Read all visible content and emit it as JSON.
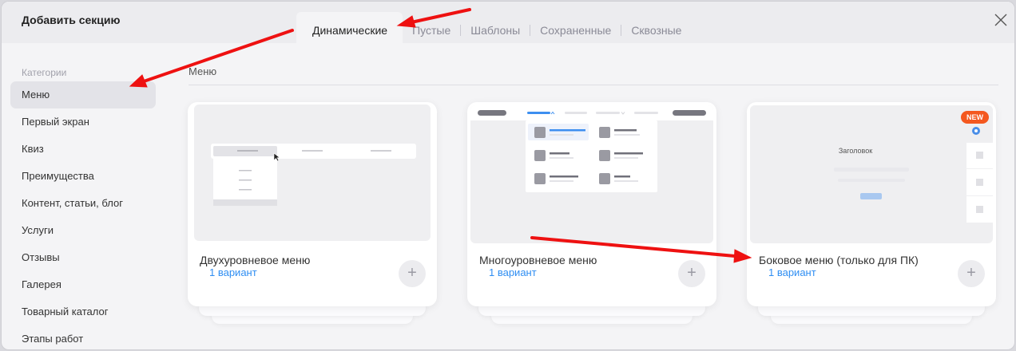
{
  "modal": {
    "title": "Добавить секцию"
  },
  "tabs": [
    {
      "label": "Динамические",
      "active": true
    },
    {
      "label": "Пустые"
    },
    {
      "label": "Шаблоны"
    },
    {
      "label": "Сохраненные"
    },
    {
      "label": "Сквозные"
    }
  ],
  "sidebar": {
    "heading": "Категории",
    "items": [
      {
        "label": "Меню",
        "active": true
      },
      {
        "label": "Первый экран"
      },
      {
        "label": "Квиз"
      },
      {
        "label": "Преимущества"
      },
      {
        "label": "Контент, статьи, блог"
      },
      {
        "label": "Услуги"
      },
      {
        "label": "Отзывы"
      },
      {
        "label": "Галерея"
      },
      {
        "label": "Товарный каталог"
      },
      {
        "label": "Этапы работ"
      }
    ]
  },
  "content": {
    "section_label": "Меню",
    "cards": [
      {
        "title": "Двухуровневое меню",
        "variant": "1 вариант",
        "add": "+"
      },
      {
        "title": "Многоуровневое меню",
        "variant": "1 вариант",
        "add": "+"
      },
      {
        "title": "Боковое меню (только для ПК)",
        "variant": "1 вариант",
        "add": "+",
        "badge": "NEW",
        "preview_heading": "Заголовок"
      }
    ]
  },
  "colors": {
    "accent": "#2f8ef2",
    "badge": "#f4581f",
    "annotation_arrow": "#ee1111"
  },
  "icons": {
    "close": "close-icon",
    "add": "plus-icon"
  }
}
